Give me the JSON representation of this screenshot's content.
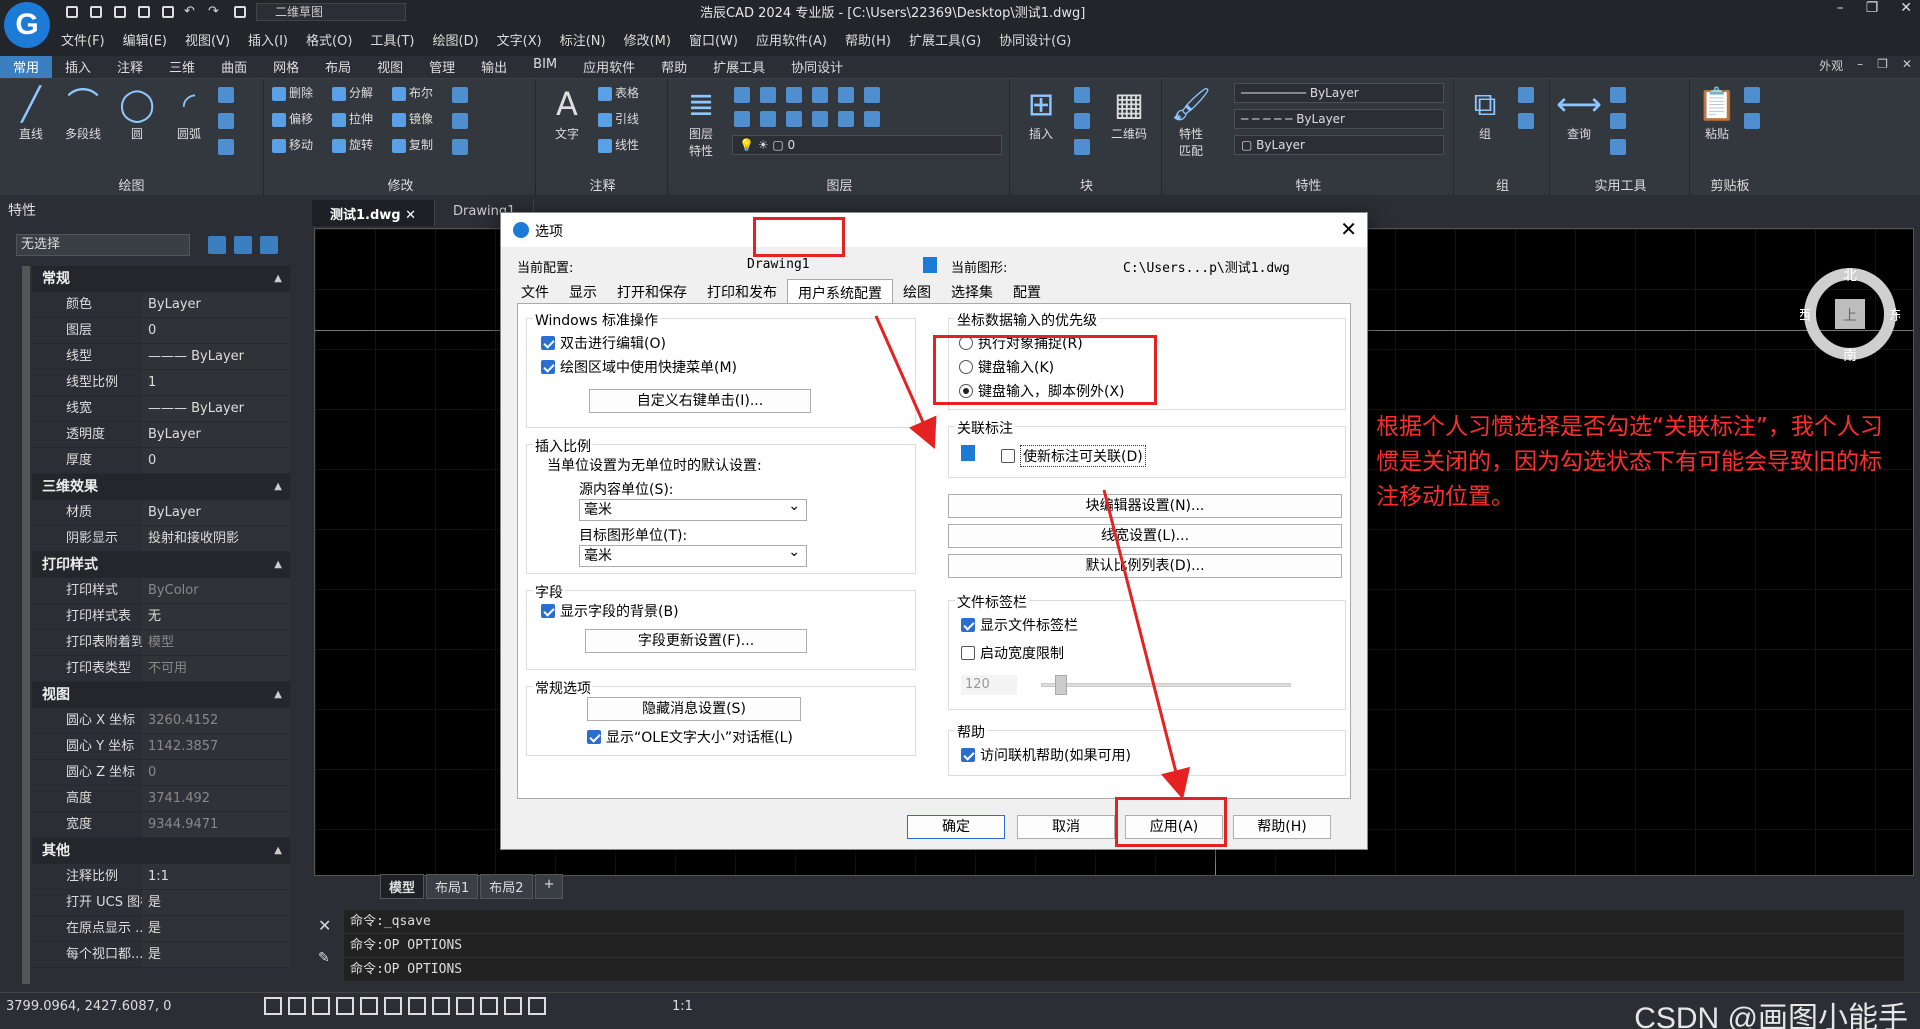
{
  "app": {
    "logo": "G",
    "title": "浩辰CAD 2024 专业版 - [C:\\Users\\22369\\Desktop\\测试1.dwg]",
    "workspace": "二维草图"
  },
  "menu": [
    "文件(F)",
    "编辑(E)",
    "视图(V)",
    "插入(I)",
    "格式(O)",
    "工具(T)",
    "绘图(D)",
    "文字(X)",
    "标注(N)",
    "修改(M)",
    "窗口(W)",
    "应用软件(A)",
    "帮助(H)",
    "扩展工具(G)",
    "协同设计(G)"
  ],
  "ribbon_tabs": [
    "常用",
    "插入",
    "注释",
    "三维",
    "曲面",
    "网格",
    "布局",
    "视图",
    "管理",
    "输出",
    "BIM",
    "应用软件",
    "帮助",
    "扩展工具",
    "协同设计"
  ],
  "ribbon_right": "外观",
  "ribbon": {
    "draw": {
      "title": "绘图",
      "line": "直线",
      "pline": "多段线",
      "circle": "圆",
      "arc": "圆弧"
    },
    "modify": {
      "title": "修改",
      "erase": "删除",
      "explode": "分解",
      "boolean": "布尔",
      "offset": "偏移",
      "stretch": "拉伸",
      "mirror": "镜像",
      "move": "移动",
      "rotate": "旋转",
      "copy": "复制"
    },
    "annotate": {
      "title": "注释",
      "text": "文字",
      "table": "表格",
      "leader": "引线",
      "linear": "线性"
    },
    "layers": {
      "title": "图层",
      "props": "图层\n特性",
      "layer_value": "0"
    },
    "block": {
      "title": "块",
      "insert": "插入",
      "qrcode": "二维码"
    },
    "properties": {
      "title": "特性",
      "match": "特性\n匹配",
      "bylayer1": "ByLayer",
      "bylayer2": "ByLayer",
      "bylayer3": "ByLayer"
    },
    "group": {
      "title": "组",
      "label": "组"
    },
    "utilities": {
      "title": "实用工具",
      "query": "查询"
    },
    "clipboard": {
      "title": "剪贴板",
      "paste": "粘贴"
    }
  },
  "props_panel": {
    "title": "特性",
    "selection": "无选择",
    "sections": [
      {
        "name": "常规",
        "rows": [
          [
            "颜色",
            "ByLayer",
            false
          ],
          [
            "图层",
            "0",
            false
          ],
          [
            "线型",
            "——— ByLayer",
            false
          ],
          [
            "线型比例",
            "1",
            false
          ],
          [
            "线宽",
            "——— ByLayer",
            false
          ],
          [
            "透明度",
            "ByLayer",
            false
          ],
          [
            "厚度",
            "0",
            false
          ]
        ]
      },
      {
        "name": "三维效果",
        "rows": [
          [
            "材质",
            "ByLayer",
            false
          ],
          [
            "阴影显示",
            "投射和接收阴影",
            false
          ]
        ]
      },
      {
        "name": "打印样式",
        "rows": [
          [
            "打印样式",
            "ByColor",
            true
          ],
          [
            "打印样式表",
            "无",
            false
          ],
          [
            "打印表附着到",
            "模型",
            true
          ],
          [
            "打印表类型",
            "不可用",
            true
          ]
        ]
      },
      {
        "name": "视图",
        "rows": [
          [
            "圆心 X 坐标",
            "3260.4152",
            true
          ],
          [
            "圆心 Y 坐标",
            "1142.3857",
            true
          ],
          [
            "圆心 Z 坐标",
            "0",
            true
          ],
          [
            "高度",
            "3741.492",
            true
          ],
          [
            "宽度",
            "9344.9471",
            true
          ]
        ]
      },
      {
        "name": "其他",
        "rows": [
          [
            "注释比例",
            "1:1",
            false
          ],
          [
            "打开 UCS 图标",
            "是",
            false
          ],
          [
            "在原点显示 ...",
            "是",
            false
          ],
          [
            "每个视口都...",
            "是",
            false
          ]
        ]
      }
    ]
  },
  "doc_tabs": [
    "测试1.dwg",
    "Drawing1"
  ],
  "layout_tabs": [
    "模型",
    "布局1",
    "布局2",
    "+"
  ],
  "viewcube": {
    "n": "北",
    "s": "南",
    "e": "东",
    "w": "西",
    "top": "上"
  },
  "commands": [
    "命令:_qsave",
    "命令:OP OPTIONS",
    "命令:OP OPTIONS"
  ],
  "status": {
    "coords": "3799.0964, 2427.6087, 0",
    "scale": "1:1"
  },
  "watermark": "CSDN @画图小能手",
  "annotation": "根据个人习惯选择是否勾选“关联标注”，我个人习惯是关闭的，因为勾选状态下有可能会导致旧的标注移动位置。",
  "dialog": {
    "title": "选项",
    "cur_config_label": "当前配置:",
    "cur_config_value": "Drawing1",
    "cur_drawing_label": "当前图形:",
    "cur_drawing_value": "C:\\Users...p\\测试1.dwg",
    "tabs": [
      "文件",
      "显示",
      "打开和保存",
      "打印和发布",
      "用户系统配置",
      "绘图",
      "选择集",
      "配置"
    ],
    "active_tab": "用户系统配置",
    "win_std": {
      "title": "Windows 标准操作",
      "dblclick": "双击进行编辑(O)",
      "shortcut": "绘图区域中使用快捷菜单(M)",
      "rightclick_btn": "自定义右键单击(I)..."
    },
    "insert_scale": {
      "title": "插入比例",
      "desc": "当单位设置为无单位时的默认设置:",
      "src_label": "源内容单位(S):",
      "src_value": "毫米",
      "tgt_label": "目标图形单位(T):",
      "tgt_value": "毫米"
    },
    "fields": {
      "title": "字段",
      "bg": "显示字段的背景(B)",
      "update_btn": "字段更新设置(F)..."
    },
    "general": {
      "title": "常规选项",
      "hidden_btn": "隐藏消息设置(S)",
      "ole": "显示“OLE文字大小”对话框(L)"
    },
    "coord_priority": {
      "title": "坐标数据输入的优先级",
      "r1": "执行对象捕捉(R)",
      "r2": "键盘输入(K)",
      "r3": "键盘输入，脚本例外(X)"
    },
    "assoc_dim": {
      "title": "关联标注",
      "cb": "使新标注可关联(D)"
    },
    "block_editor_btn": "块编辑器设置(N)...",
    "lineweight_btn": "线宽设置(L)...",
    "scale_list_btn": "默认比例列表(D)...",
    "file_tabs": {
      "title": "文件标签栏",
      "show": "显示文件标签栏",
      "width": "启动宽度限制",
      "width_value": "120"
    },
    "help": {
      "title": "帮助",
      "online": "访问联机帮助(如果可用)"
    },
    "ok": "确定",
    "cancel": "取消",
    "apply": "应用(A)",
    "helpbtn": "帮助(H)"
  }
}
